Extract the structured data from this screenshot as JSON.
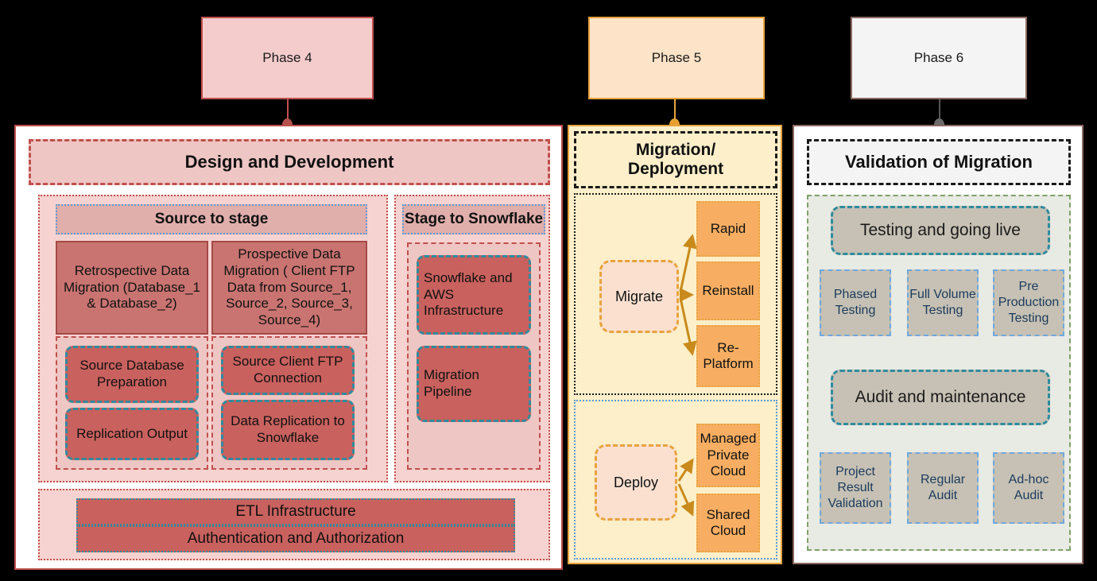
{
  "phases": [
    {
      "id": "phase4",
      "label": "Phase 4",
      "accent": "#C0504D",
      "section_title": "Design and Development"
    },
    {
      "id": "phase5",
      "label": "Phase 5",
      "accent": "#E8A33D",
      "section_title": "Migration/ Deployment"
    },
    {
      "id": "phase6",
      "label": "Phase 6",
      "accent": "#6B6B6B",
      "section_title": "Validation of Migration"
    }
  ],
  "phase4": {
    "label": "Phase 4",
    "section_title": "Design and Development",
    "source_to_stage": {
      "heading": "Source to stage",
      "cards": [
        "Retrospective Data Migration (Database_1 & Database_2)",
        "Prospective Data Migration ( Client FTP Data from Source_1, Source_2, Source_3, Source_4)"
      ],
      "left_group": [
        "Source Database Preparation",
        "Replication Output"
      ],
      "right_group": [
        "Source Client FTP Connection",
        "Data Replication to Snowflake"
      ]
    },
    "stage_to_snowflake": {
      "heading": "Stage to Snowflake",
      "cards": [
        "Snowflake and AWS Infrastructure",
        "Migration Pipeline"
      ]
    },
    "bottom_bars": [
      "ETL Infrastructure",
      "Authentication and Authorization"
    ]
  },
  "phase5": {
    "label": "Phase 5",
    "section_title_line1": "Migration/",
    "section_title_line2": "Deployment",
    "migrate": {
      "source": "Migrate",
      "targets": [
        "Rapid",
        "Reinstall",
        "Re-Platform"
      ]
    },
    "deploy": {
      "source": "Deploy",
      "targets": [
        "Managed Private Cloud",
        "Shared Cloud"
      ]
    }
  },
  "phase6": {
    "label": "Phase 6",
    "section_title": "Validation of Migration",
    "testing": {
      "heading": "Testing and going live",
      "items": [
        "Phased Testing",
        "Full Volume Testing",
        "Pre Production Testing"
      ]
    },
    "audit": {
      "heading": "Audit and maintenance",
      "items": [
        "Project Result Validation",
        "Regular Audit",
        "Ad-hoc Audit"
      ]
    }
  },
  "colors": {
    "phase4_accent": "#C0504D",
    "phase5_accent": "#E8A33D",
    "phase6_accent": "#6B6B6B",
    "card_red": "#C9615E",
    "card_orange": "#F7AE62",
    "card_gray": "#C6C1B4",
    "background": "#000000"
  }
}
